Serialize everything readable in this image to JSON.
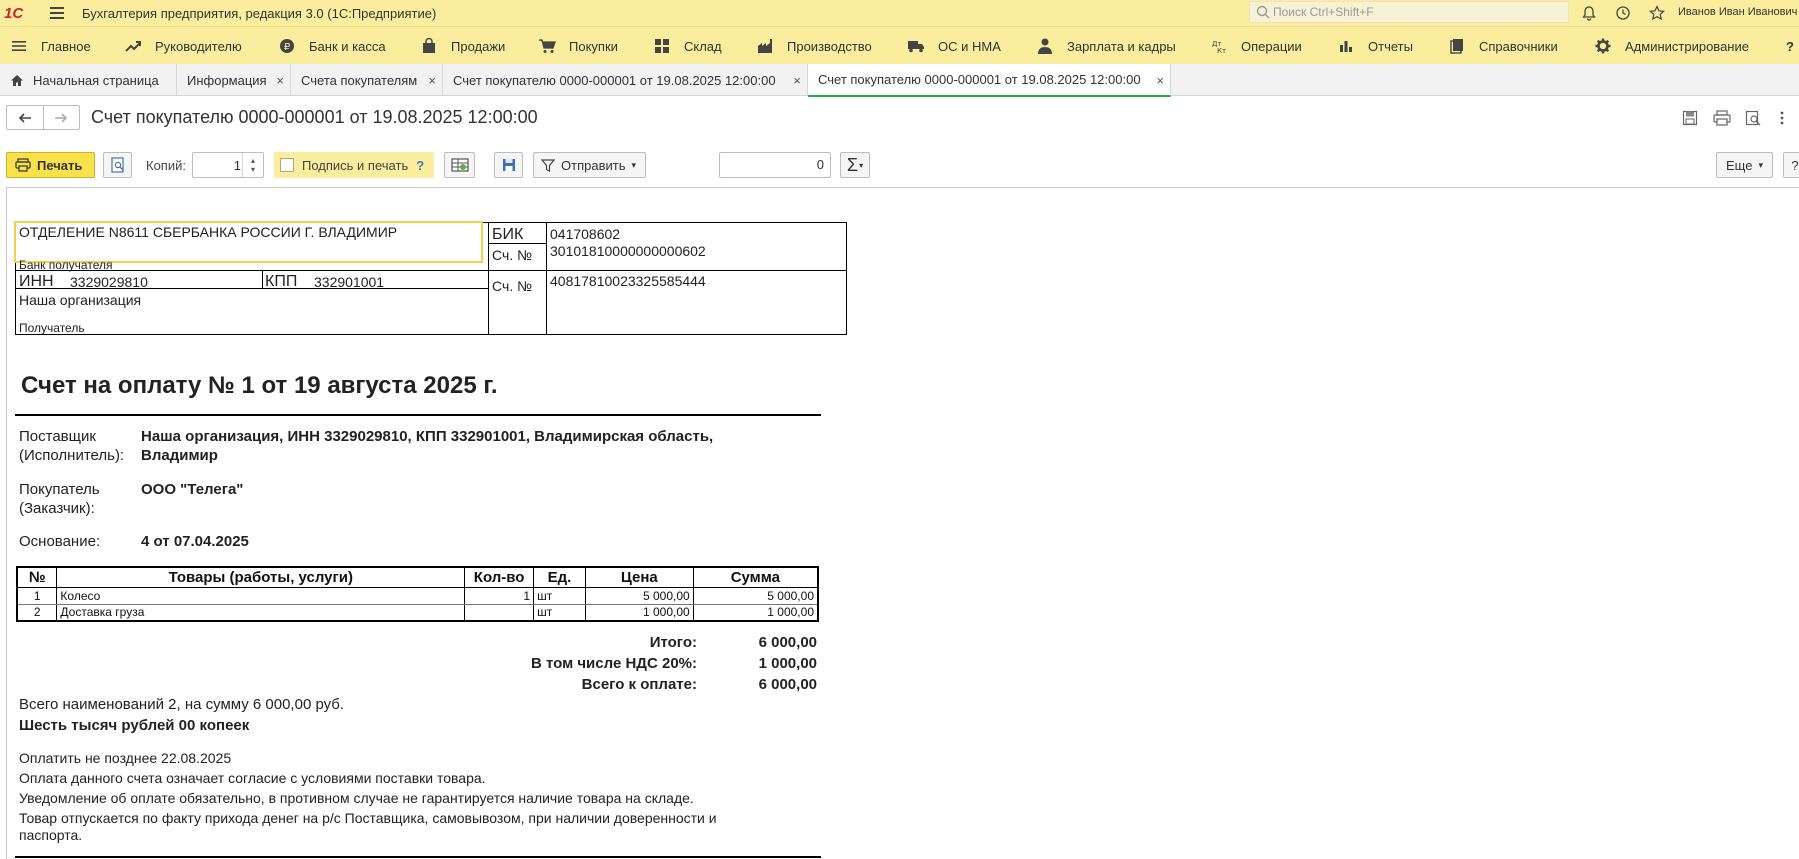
{
  "titlebar": {
    "logo": "1С",
    "app_title": "Бухгалтерия предприятия, редакция 3.0  (1С:Предприятие)",
    "search_placeholder": "Поиск Ctrl+Shift+F",
    "user": "Иванов Иван Иванович"
  },
  "sections": [
    {
      "label": "Главное",
      "icon": "hamburger-icon"
    },
    {
      "label": "Руководителю",
      "icon": "trend-icon"
    },
    {
      "label": "Банк и касса",
      "icon": "ruble-icon"
    },
    {
      "label": "Продажи",
      "icon": "bag-icon"
    },
    {
      "label": "Покупки",
      "icon": "cart-icon"
    },
    {
      "label": "Склад",
      "icon": "grid-icon"
    },
    {
      "label": "Производство",
      "icon": "factory-icon"
    },
    {
      "label": "ОС и НМА",
      "icon": "truck-icon"
    },
    {
      "label": "Зарплата и кадры",
      "icon": "person-icon"
    },
    {
      "label": "Операции",
      "icon": "dtkt-icon"
    },
    {
      "label": "Отчеты",
      "icon": "bar-chart-icon"
    },
    {
      "label": "Справочники",
      "icon": "book-icon"
    },
    {
      "label": "Администрирование",
      "icon": "gear-icon"
    },
    {
      "label": "?",
      "icon": "help-icon"
    }
  ],
  "tabs": [
    {
      "label": "Начальная страница"
    },
    {
      "label": "Информация"
    },
    {
      "label": "Счета покупателям"
    },
    {
      "label": "Счет покупателю 0000-000001 от 19.08.2025 12:00:00"
    },
    {
      "label": "Счет покупателю 0000-000001 от 19.08.2025 12:00:00"
    }
  ],
  "tab_close": "×",
  "form": {
    "title": "Счет покупателю 0000-000001 от 19.08.2025 12:00:00"
  },
  "toolbar": {
    "print_label": "Печать",
    "copies_label": "Копий:",
    "copies_value": "1",
    "sign_print_label": "Подпись и печать",
    "sign_help": "?",
    "send_label": "Отправить",
    "sum_value": "0",
    "more_label": "Еще",
    "help": "?"
  },
  "bank": {
    "bank_name": "ОТДЕЛЕНИЕ N8611 СБЕРБАНКА РОССИИ Г. ВЛАДИМИР",
    "bank_caption": "Банк получателя",
    "bik_label": "БИК",
    "bik_value": "041708602",
    "corr_label": "Сч. №",
    "corr_value": "30101810000000000602",
    "inn_label": "ИНН",
    "inn_value": "3329029810",
    "kpp_label": "КПП",
    "kpp_value": "332901001",
    "acc_label": "Сч. №",
    "acc_value": "40817810023325585444",
    "recipient_name": "Наша организация",
    "recipient_caption": "Получатель"
  },
  "invoice": {
    "title": "Счет на оплату № 1 от 19 августа 2025 г.",
    "supplier_label_1": "Поставщик",
    "supplier_label_2": "(Исполнитель):",
    "supplier_value_1": "Наша организация, ИНН 3329029810, КПП 332901001, Владимирская область,",
    "supplier_value_2": "Владимир",
    "buyer_label_1": "Покупатель",
    "buyer_label_2": "(Заказчик):",
    "buyer_value": "ООО \"Телега\"",
    "basis_label": "Основание:",
    "basis_value": "4 от 07.04.2025"
  },
  "items_table": {
    "headers": [
      "№",
      "Товары (работы, услуги)",
      "Кол-во",
      "Ед.",
      "Цена",
      "Сумма"
    ],
    "rows": [
      [
        "1",
        "Колесо",
        "1",
        "шт",
        "5 000,00",
        "5 000,00"
      ],
      [
        "2",
        "Доставка груза",
        "",
        "шт",
        "1 000,00",
        "1 000,00"
      ]
    ]
  },
  "totals": {
    "total_label": "Итого:",
    "total_value": "6 000,00",
    "vat_label": "В том числе НДС 20%:",
    "vat_value": "1 000,00",
    "pay_label": "Всего к оплате:",
    "pay_value": "6 000,00"
  },
  "summary": {
    "count_line": "Всего наименований 2, на сумму 6 000,00 руб.",
    "in_words": "Шесть тысяч рублей 00 копеек"
  },
  "terms": {
    "due": "Оплатить не позднее 22.08.2025",
    "line1": "Оплата данного счета означает согласие с условиями поставки товара.",
    "line2": "Уведомление об оплате обязательно, в противном случае не гарантируется наличие товара на складе.",
    "line3a": "Товар отпускается по факту прихода денег на р/с Поставщика, самовывозом, при наличии доверенности и",
    "line3b": "паспорта."
  },
  "colors": {
    "titlebar_bg": "#fbed9e",
    "print_button": "#f8e14b",
    "active_tab_underline": "#2ba84a",
    "logo": "#d1222a"
  }
}
